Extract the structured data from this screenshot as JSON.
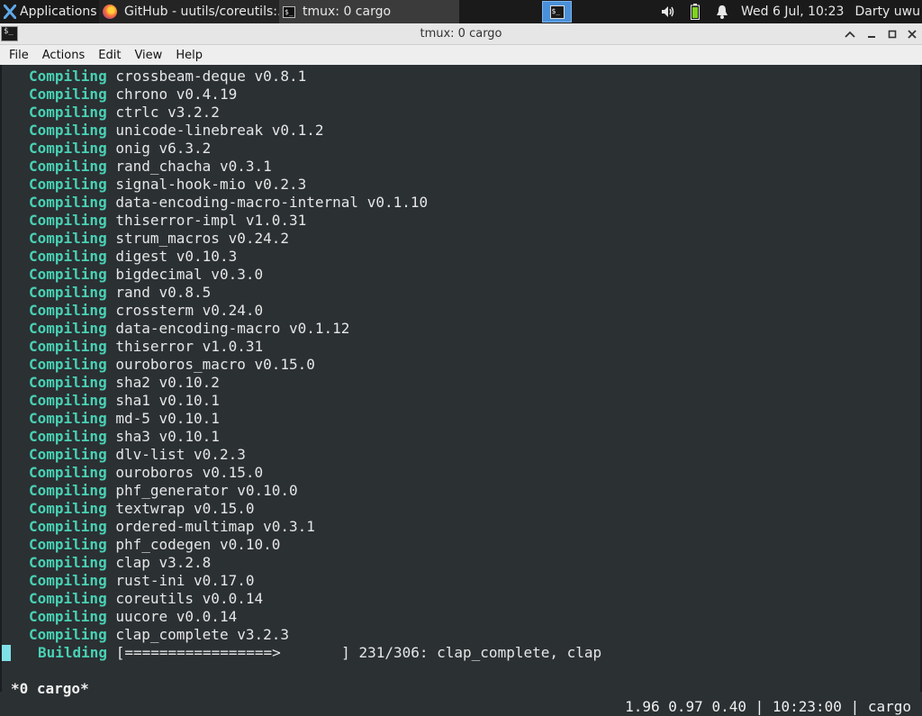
{
  "panel": {
    "applications_label": "Applications",
    "tasks": [
      {
        "title": "GitHub - uutils/coreutils:..."
      },
      {
        "title": "tmux: 0 cargo"
      }
    ],
    "clock": "Wed  6 Jul, 10:23",
    "user": "Darty uwu"
  },
  "window": {
    "title": "tmux: 0 cargo"
  },
  "menubar": {
    "items": [
      "File",
      "Actions",
      "Edit",
      "View",
      "Help"
    ]
  },
  "terminal": {
    "keyword": "Compiling",
    "lines": [
      "crossbeam-deque v0.8.1",
      "chrono v0.4.19",
      "ctrlc v3.2.2",
      "unicode-linebreak v0.1.2",
      "onig v6.3.2",
      "rand_chacha v0.3.1",
      "signal-hook-mio v0.2.3",
      "data-encoding-macro-internal v0.1.10",
      "thiserror-impl v1.0.31",
      "strum_macros v0.24.2",
      "digest v0.10.3",
      "bigdecimal v0.3.0",
      "rand v0.8.5",
      "crossterm v0.24.0",
      "data-encoding-macro v0.1.12",
      "thiserror v1.0.31",
      "ouroboros_macro v0.15.0",
      "sha2 v0.10.2",
      "sha1 v0.10.1",
      "md-5 v0.10.1",
      "sha3 v0.10.1",
      "dlv-list v0.2.3",
      "ouroboros v0.15.0",
      "phf_generator v0.10.0",
      "textwrap v0.15.0",
      "ordered-multimap v0.3.1",
      "phf_codegen v0.10.0",
      "clap v3.2.8",
      "rust-ini v0.17.0",
      "coreutils v0.0.14",
      "uucore v0.0.14",
      "clap_complete v3.2.3"
    ],
    "building_label": "Building",
    "progress_bar": "[=================>       ]",
    "progress_text": "231/306: clap_complete, clap"
  },
  "tmux_status": {
    "left": "*0 cargo*",
    "right": "1.96 0.97 0.40 | 10:23:00 | cargo"
  }
}
